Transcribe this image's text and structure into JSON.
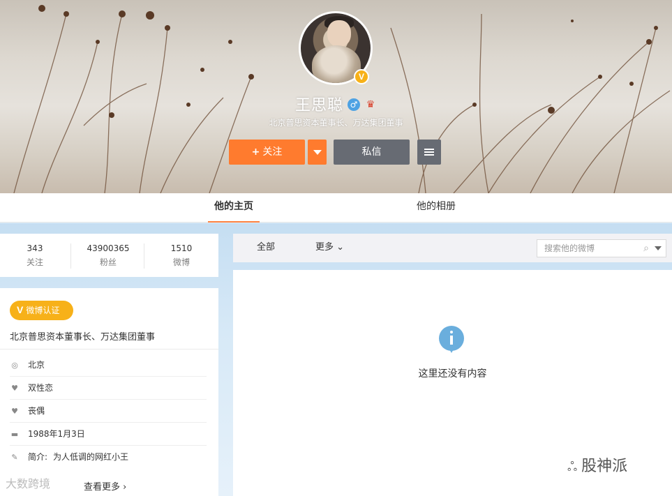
{
  "profile": {
    "name": "王思聪",
    "verified_badge": "V",
    "gender_icon": "♂",
    "crown_icon": "♛",
    "subtitle": "北京普思资本董事长、万达集团董事"
  },
  "actions": {
    "follow_plus": "+",
    "follow_label": "关注",
    "message_label": "私信"
  },
  "tabs": [
    {
      "label": "他的主页",
      "active": true
    },
    {
      "label": "他的相册",
      "active": false
    }
  ],
  "stats": [
    {
      "value": "343",
      "label": "关注"
    },
    {
      "value": "43900365",
      "label": "粉丝"
    },
    {
      "value": "1510",
      "label": "微博"
    }
  ],
  "info": {
    "verify_tag": "微博认证",
    "verify_letter": "V",
    "title": "北京普思资本董事长、万达集团董事",
    "rows": [
      {
        "icon": "location-icon",
        "glyph": "◎",
        "label": "",
        "text": "北京"
      },
      {
        "icon": "heart-icon",
        "glyph": "♥",
        "label": "",
        "text": "双性恋"
      },
      {
        "icon": "relationship-icon",
        "glyph": "♥",
        "label": "",
        "text": "丧偶"
      },
      {
        "icon": "birthday-cake-icon",
        "glyph": "▬",
        "label": "",
        "text": "1988年1月3日"
      },
      {
        "icon": "intro-icon",
        "glyph": "✎",
        "label": "简介:",
        "text": "为人低调的网红小王"
      }
    ],
    "more_label": "查看更多",
    "more_arrow": "›"
  },
  "feed": {
    "filter_all": "全部",
    "filter_more": "更多",
    "filter_more_arrow": "⌄",
    "search_placeholder": "搜索他的微博",
    "search_glyph": "⌕",
    "empty_text": "这里还没有内容"
  },
  "watermarks": {
    "left": "大数跨境",
    "right_glyph": "ஃ",
    "right": "股神派"
  },
  "colors": {
    "accent": "#ff7b2e",
    "button_gray": "#676b73",
    "verified_gold": "#f7b119",
    "info_blue": "#6aaedd"
  }
}
